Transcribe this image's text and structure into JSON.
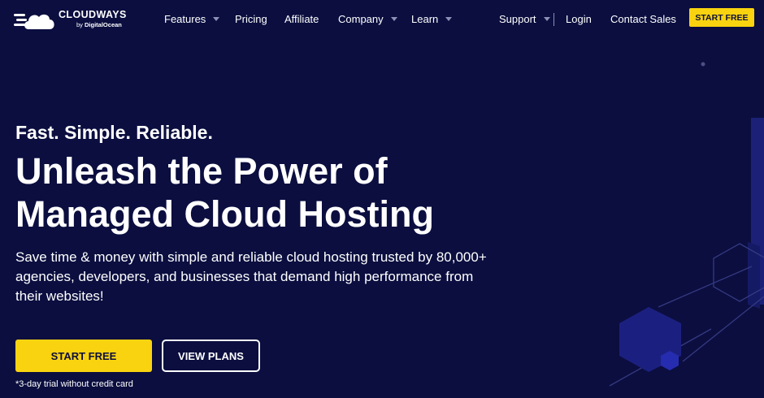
{
  "brand": {
    "name": "CLOUDWAYS",
    "sub_prefix": "by",
    "sub_brand": "DigitalOcean"
  },
  "nav": {
    "features": "Features",
    "pricing": "Pricing",
    "affiliate": "Affiliate",
    "company": "Company",
    "learn": "Learn",
    "support": "Support",
    "login": "Login",
    "contact_sales": "Contact Sales",
    "start_free": "START FREE"
  },
  "hero": {
    "tagline": "Fast. Simple. Reliable.",
    "headline_line1": "Unleash the Power of",
    "headline_line2": "Managed Cloud Hosting",
    "subtext": "Save time & money with simple and reliable cloud hosting trusted by 80,000+ agencies, developers, and businesses that demand high performance from their websites!",
    "primary_cta": "START FREE",
    "secondary_cta": "VIEW PLANS",
    "footnote": "*3-day trial without credit card"
  },
  "colors": {
    "background": "#0b0e3f",
    "accent": "#f9d30f",
    "text": "#ffffff",
    "caret": "#8d91b5"
  }
}
